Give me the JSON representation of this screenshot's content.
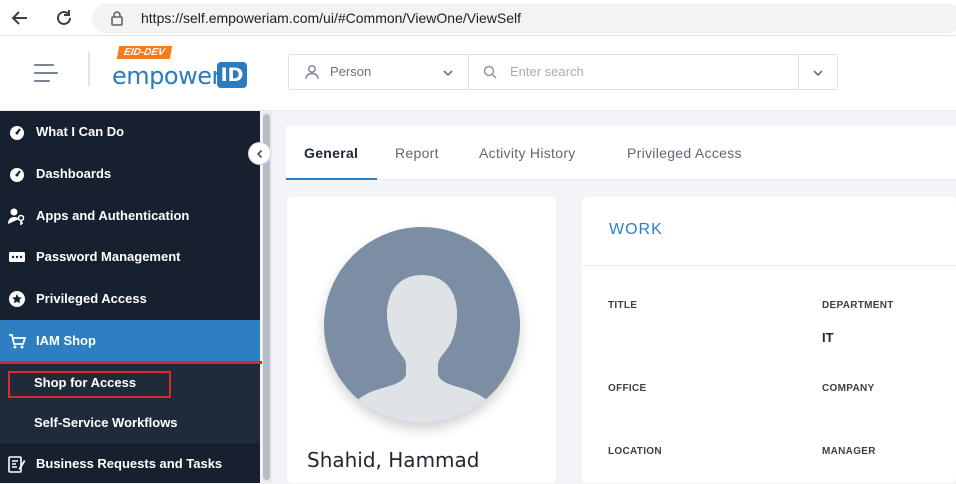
{
  "browser": {
    "url": "https://self.empoweriam.com/ui/#Common/ViewOne/ViewSelf"
  },
  "header": {
    "logo_badge": "EID-DEV",
    "logo_word": "empower",
    "logo_id": "ID",
    "search_type": "Person",
    "search_placeholder": "Enter search"
  },
  "sidebar": {
    "items": [
      {
        "label": "What I Can Do",
        "icon": "dashboard-gauge-icon"
      },
      {
        "label": "Dashboards",
        "icon": "dashboard-gauge-icon"
      },
      {
        "label": "Apps and Authentication",
        "icon": "user-key-icon"
      },
      {
        "label": "Password Management",
        "icon": "password-card-icon"
      },
      {
        "label": "Privileged Access",
        "icon": "badge-star-icon"
      },
      {
        "label": "IAM Shop",
        "icon": "shopping-cart-icon"
      },
      {
        "label": "Business Requests and Tasks",
        "icon": "edit-checklist-icon"
      }
    ],
    "sub_items": [
      {
        "label": "Shop for Access"
      },
      {
        "label": "Self-Service Workflows"
      }
    ]
  },
  "tabs": [
    {
      "label": "General"
    },
    {
      "label": "Report"
    },
    {
      "label": "Activity History"
    },
    {
      "label": "Privileged Access"
    }
  ],
  "profile": {
    "name": "Shahid, Hammad"
  },
  "work": {
    "title": "WORK",
    "fields": [
      {
        "label": "TITLE",
        "value": ""
      },
      {
        "label": "DEPARTMENT",
        "value": "IT"
      },
      {
        "label": "OFFICE",
        "value": ""
      },
      {
        "label": "COMPANY",
        "value": ""
      },
      {
        "label": "LOCATION",
        "value": ""
      },
      {
        "label": "MANAGER",
        "value": ""
      }
    ]
  },
  "colors": {
    "accent": "#2e7fc1",
    "sidebar_bg": "#16202e",
    "highlight_red": "#e0262f",
    "logo_orange": "#f47b20"
  }
}
